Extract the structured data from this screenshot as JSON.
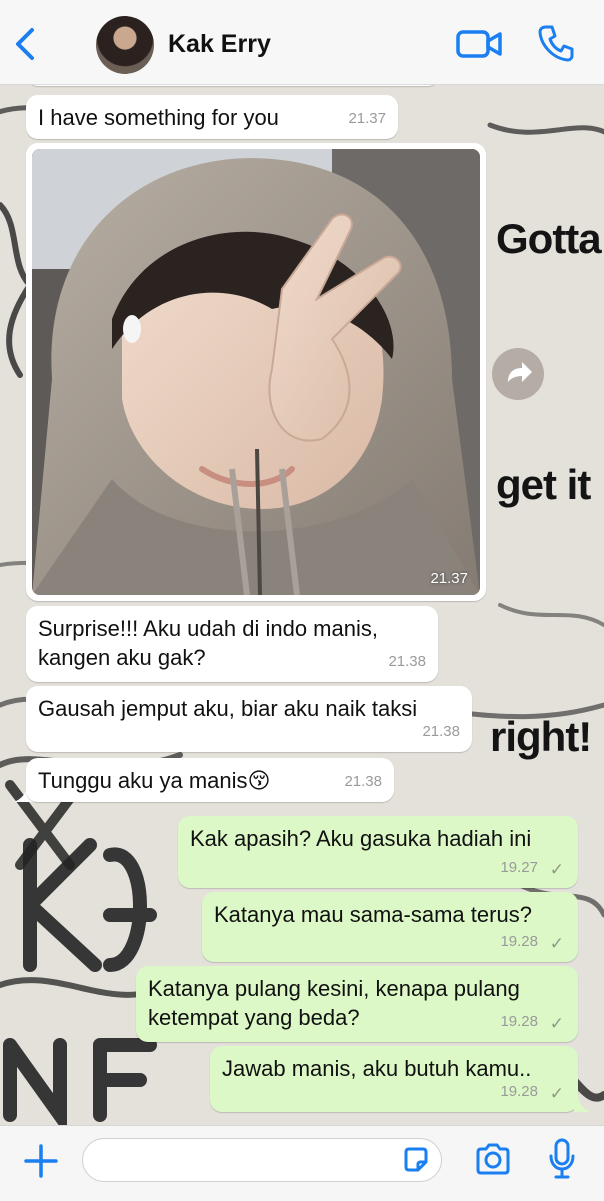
{
  "header": {
    "contact_name": "Kak Erry",
    "icons": {
      "back": "chevron-left-icon",
      "video": "video-camera-icon",
      "call": "phone-icon"
    },
    "accent_color": "#1a7ff0"
  },
  "wallpaper": {
    "text": [
      "Gotta",
      "get it",
      "right!"
    ]
  },
  "messages": [
    {
      "dir": "in",
      "text": "I have something for you",
      "time": "21.37"
    },
    {
      "dir": "in",
      "type": "photo",
      "time": "21.37"
    },
    {
      "dir": "in",
      "text": "Surprise!!! Aku udah di indo manis, kangen aku gak?",
      "time": "21.38"
    },
    {
      "dir": "in",
      "text": "Gausah jemput aku, biar aku naik taksi",
      "time": "21.38"
    },
    {
      "dir": "in",
      "text": "Tunggu aku ya manis😚",
      "time": "21.38"
    },
    {
      "dir": "out",
      "text": "Kak apasih? Aku gasuka hadiah ini",
      "time": "19.27",
      "status": "✓"
    },
    {
      "dir": "out",
      "text": "Katanya mau sama-sama terus?",
      "time": "19.28",
      "status": "✓"
    },
    {
      "dir": "out",
      "text": "Katanya pulang kesini, kenapa pulang ketempat yang beda?",
      "time": "19.28",
      "status": "✓"
    },
    {
      "dir": "out",
      "text": "Jawab manis, aku butuh kamu..",
      "time": "19.28",
      "status": "✓"
    }
  ],
  "input_bar": {
    "placeholder": "",
    "icons": {
      "add": "plus-icon",
      "sticker": "sticker-icon",
      "camera": "camera-icon",
      "mic": "microphone-icon"
    }
  },
  "colors": {
    "incoming_bubble": "#ffffff",
    "outgoing_bubble": "#dcf8c6",
    "accent": "#1a7ff0"
  }
}
